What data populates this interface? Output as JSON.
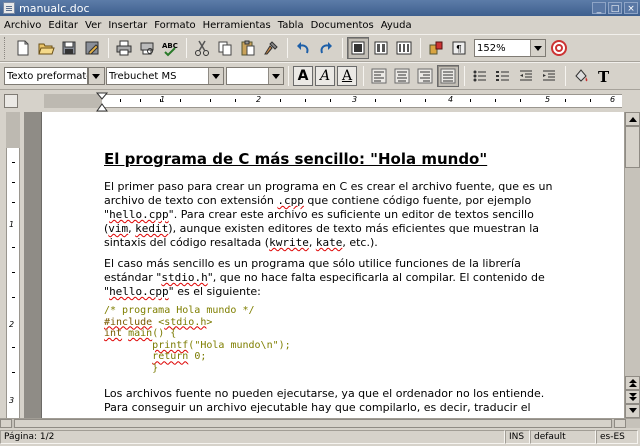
{
  "window": {
    "title": "manualc.doc",
    "controls": [
      "_",
      "□",
      "×"
    ]
  },
  "menu": [
    "Archivo",
    "Editar",
    "Ver",
    "Insertar",
    "Formato",
    "Herramientas",
    "Tabla",
    "Documentos",
    "Ayuda"
  ],
  "toolbar": {
    "zoom": "152%",
    "icons": [
      "new-document-icon",
      "open-folder-icon",
      "save-icon",
      "edit-icon",
      "print-icon",
      "print-preview-icon",
      "spellcheck-icon",
      "cut-icon",
      "copy-icon",
      "paste-icon",
      "format-painter-icon",
      "undo-icon",
      "redo-icon",
      "normal-view-icon",
      "page-view-icon",
      "columns-icon",
      "insert-object-icon",
      "insert-image-icon",
      "help-icon"
    ]
  },
  "format_toolbar": {
    "style": "Texto preformatea",
    "font": "Trebuchet MS",
    "size": "",
    "bold": "A",
    "italic": "A",
    "underline": "A"
  },
  "ruler": {
    "h_labels": [
      "1",
      "2",
      "3",
      "4",
      "5",
      "6",
      "7"
    ],
    "v_labels": [
      "1",
      "2",
      "3"
    ]
  },
  "doc": {
    "heading": "El programa de C más sencillo: \"Hola mundo\"",
    "p1": [
      "El primer paso para crear un programa en C es crear el archivo fuente, que es un",
      "archivo de texto con extensión ",
      ".cpp",
      " que contiene código fuente, por ejemplo",
      "\"",
      "hello.cpp",
      "\". Para crear este archivo es suficiente un editor de textos sencillo",
      "(",
      "vim",
      ", ",
      "kedit",
      "), aunque existen editores de texto más eficientes que muestran la",
      "sintaxis del código resaltada (",
      "kwrite",
      ", ",
      "kate",
      ", etc.)."
    ],
    "p2": [
      "El caso más sencillo es un programa que sólo utilice funciones de la librería",
      "estándar \"",
      "stdio.h",
      "\", que no hace falta especificarla al compilar. El contenido de",
      "\"",
      "hello.cpp",
      "\" es el siguiente:"
    ],
    "code": [
      "/* programa Hola mundo */",
      "#include",
      " <",
      "stdio.h",
      ">",
      "int",
      " ",
      "main",
      "() {",
      "        ",
      "printf",
      "(\"Hola mundo\\n\");",
      "        ",
      "return",
      " 0;",
      "        }"
    ],
    "p3": [
      "Los archivos fuente no pueden ejecutarse, ya que el ordenador no los entiende.",
      "Para conseguir un archivo ejecutable hay que compilarlo, es decir, traducir el"
    ]
  },
  "status": {
    "page": "Página: 1/2",
    "mode": "INS",
    "style": "default",
    "lang": "es-ES"
  }
}
